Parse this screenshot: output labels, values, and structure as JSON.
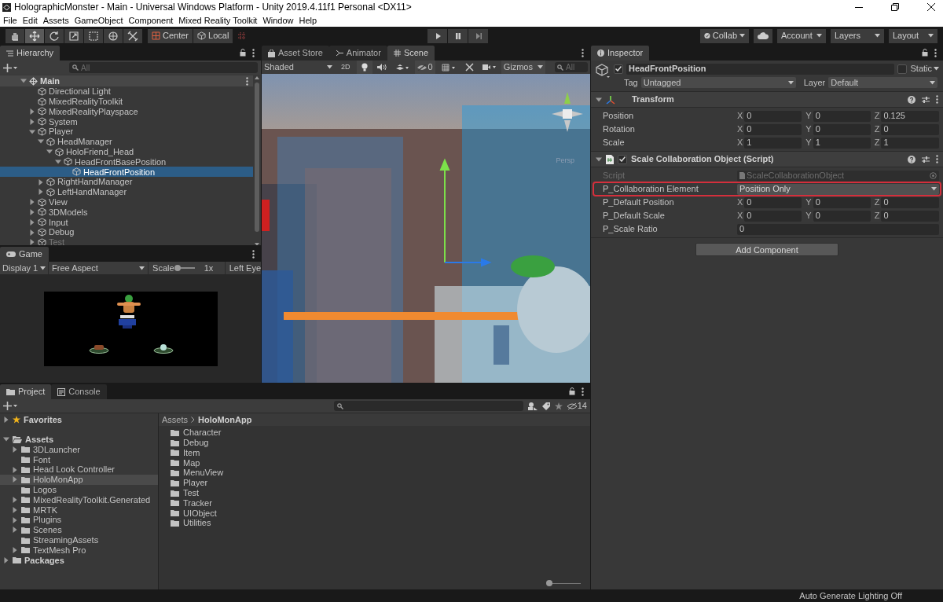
{
  "window": {
    "title": "HolographicMonster - Main - Universal Windows Platform - Unity 2019.4.11f1 Personal <DX11>"
  },
  "menu": [
    "File",
    "Edit",
    "Assets",
    "GameObject",
    "Component",
    "Mixed Reality Toolkit",
    "Window",
    "Help"
  ],
  "toolbar": {
    "tools": [
      {
        "kind": "hand",
        "selected": false
      },
      {
        "kind": "move",
        "selected": true
      },
      {
        "kind": "rotate",
        "selected": false
      },
      {
        "kind": "scale",
        "selected": false
      },
      {
        "kind": "rect",
        "selected": false
      },
      {
        "kind": "transform",
        "selected": false
      },
      {
        "kind": "custom",
        "selected": false
      }
    ],
    "pivot": "Center",
    "space": "Local",
    "collab": "Collab",
    "account": "Account",
    "layers": "Layers",
    "layout": "Layout"
  },
  "hierarchy": {
    "tab": "Hierarchy",
    "search_placeholder": "All",
    "scene": "Main",
    "items": [
      {
        "name": "Directional Light",
        "selected": false,
        "disabled": false
      },
      {
        "name": "MixedRealityToolkit",
        "selected": false,
        "disabled": false
      },
      {
        "name": "MixedRealityPlayspace",
        "expanded": false,
        "selected": false,
        "disabled": false
      },
      {
        "name": "System",
        "expanded": false,
        "selected": false,
        "disabled": false
      },
      {
        "name": "Player",
        "expanded": true,
        "selected": false,
        "disabled": false,
        "children": [
          {
            "name": "HeadManager",
            "expanded": true,
            "selected": false,
            "disabled": false,
            "children": [
              {
                "name": "HoloFriend_Head",
                "expanded": true,
                "selected": false,
                "disabled": false,
                "children": [
                  {
                    "name": "HeadFrontBasePosition",
                    "expanded": true,
                    "selected": false,
                    "disabled": false,
                    "children": [
                      {
                        "name": "HeadFrontPosition",
                        "selected": true,
                        "disabled": false
                      }
                    ]
                  }
                ]
              }
            ]
          },
          {
            "name": "RightHandManager",
            "expanded": false,
            "selected": false,
            "disabled": false
          },
          {
            "name": "LeftHandManager",
            "expanded": false,
            "selected": false,
            "disabled": false
          }
        ]
      },
      {
        "name": "View",
        "expanded": false,
        "selected": false,
        "disabled": false
      },
      {
        "name": "3DModels",
        "expanded": false,
        "selected": false,
        "disabled": false
      },
      {
        "name": "Input",
        "expanded": false,
        "selected": false,
        "disabled": false
      },
      {
        "name": "Debug",
        "expanded": false,
        "selected": false,
        "disabled": false
      },
      {
        "name": "Test",
        "expanded": false,
        "selected": false,
        "disabled": true
      }
    ]
  },
  "game": {
    "tab": "Game",
    "display": "Display 1",
    "aspect": "Free Aspect",
    "scale_label": "Scale",
    "scale_slider": {
      "level": 0
    },
    "scale_reading": "1x",
    "eye": "Left Eye"
  },
  "scene_view": {
    "tabs": [
      {
        "label": "Asset Store",
        "kind": "store",
        "selected": false
      },
      {
        "label": "Animator",
        "kind": "animator",
        "selected": false
      },
      {
        "label": "Scene",
        "kind": "scene",
        "selected": true
      }
    ],
    "shading": "Shaded",
    "mode_2d": "2D",
    "hidden_count": "0",
    "gizmos": "Gizmos",
    "search_placeholder": "All",
    "view_label": "Persp"
  },
  "inspector": {
    "tab": "Inspector",
    "object": {
      "active": true,
      "name": "HeadFrontPosition",
      "static": false,
      "static_label": "Static",
      "tag_label": "Tag",
      "tag": "Untagged",
      "layer_label": "Layer",
      "layer": "Default"
    },
    "components": [
      {
        "kind": "transform",
        "title": "Transform",
        "expanded": true,
        "rows": [
          {
            "label": "Position",
            "kind": "vector3",
            "disabled": false,
            "highlighted": false,
            "values": [
              {
                "axis": "X",
                "value": "0"
              },
              {
                "axis": "Y",
                "value": "0"
              },
              {
                "axis": "Z",
                "value": "0.125"
              }
            ]
          },
          {
            "label": "Rotation",
            "kind": "vector3",
            "disabled": false,
            "highlighted": false,
            "values": [
              {
                "axis": "X",
                "value": "0"
              },
              {
                "axis": "Y",
                "value": "0"
              },
              {
                "axis": "Z",
                "value": "0"
              }
            ]
          },
          {
            "label": "Scale",
            "kind": "vector3",
            "disabled": false,
            "highlighted": false,
            "values": [
              {
                "axis": "X",
                "value": "1"
              },
              {
                "axis": "Y",
                "value": "1"
              },
              {
                "axis": "Z",
                "value": "1"
              }
            ]
          }
        ]
      },
      {
        "kind": "script",
        "title": "Scale Collaboration Object (Script)",
        "enabled": true,
        "expanded": true,
        "rows": [
          {
            "label": "Script",
            "kind": "object",
            "disabled": true,
            "highlighted": false,
            "value": "ScaleCollaborationObject"
          },
          {
            "label": "P_Collaboration Element",
            "kind": "dropdown",
            "disabled": false,
            "highlighted": true,
            "value": "Position Only"
          },
          {
            "label": "P_Default Position",
            "kind": "vector3",
            "disabled": false,
            "highlighted": false,
            "values": [
              {
                "axis": "X",
                "value": "0"
              },
              {
                "axis": "Y",
                "value": "0"
              },
              {
                "axis": "Z",
                "value": "0"
              }
            ]
          },
          {
            "label": "P_Default Scale",
            "kind": "vector3",
            "disabled": false,
            "highlighted": false,
            "values": [
              {
                "axis": "X",
                "value": "0"
              },
              {
                "axis": "Y",
                "value": "0"
              },
              {
                "axis": "Z",
                "value": "0"
              }
            ]
          },
          {
            "label": "P_Scale Ratio",
            "kind": "float",
            "disabled": false,
            "highlighted": false,
            "value": "0"
          }
        ]
      }
    ],
    "add_button": "Add Component"
  },
  "project": {
    "tabs": [
      {
        "label": "Project",
        "kind": "project",
        "selected": true
      },
      {
        "label": "Console",
        "kind": "console",
        "selected": false
      }
    ],
    "hidden_count": "14",
    "tree": [
      {
        "name": "Favorites",
        "kind": "favorites",
        "expanded": false,
        "selected": false
      },
      {
        "name": "Assets",
        "kind": "folder",
        "expanded": true,
        "selected": false,
        "children": [
          {
            "name": "3DLauncher",
            "kind": "folder",
            "expanded": false,
            "selected": false
          },
          {
            "name": "Font",
            "kind": "folder",
            "selected": false
          },
          {
            "name": "Head Look Controller",
            "kind": "folder",
            "expanded": false,
            "selected": false
          },
          {
            "name": "HoloMonApp",
            "kind": "folder",
            "expanded": false,
            "selected": true
          },
          {
            "name": "Logos",
            "kind": "folder",
            "selected": false
          },
          {
            "name": "MixedRealityToolkit.Generated",
            "kind": "folder",
            "expanded": false,
            "selected": false
          },
          {
            "name": "MRTK",
            "kind": "folder",
            "expanded": false,
            "selected": false
          },
          {
            "name": "Plugins",
            "kind": "folder",
            "expanded": false,
            "selected": false
          },
          {
            "name": "Scenes",
            "kind": "folder",
            "expanded": false,
            "selected": false
          },
          {
            "name": "StreamingAssets",
            "kind": "folder",
            "selected": false
          },
          {
            "name": "TextMesh Pro",
            "kind": "folder",
            "expanded": false,
            "selected": false
          }
        ]
      },
      {
        "name": "Packages",
        "kind": "folder",
        "expanded": false,
        "selected": false
      }
    ],
    "breadcrumb": [
      "Assets",
      "HoloMonApp"
    ],
    "folders": [
      "Character",
      "Debug",
      "Item",
      "Map",
      "MenuView",
      "Player",
      "Test",
      "Tracker",
      "UIObject",
      "Utilities"
    ],
    "zoom_slider": {
      "level": 0
    }
  },
  "status_bar": {
    "text": "Auto Generate Lighting Off"
  }
}
